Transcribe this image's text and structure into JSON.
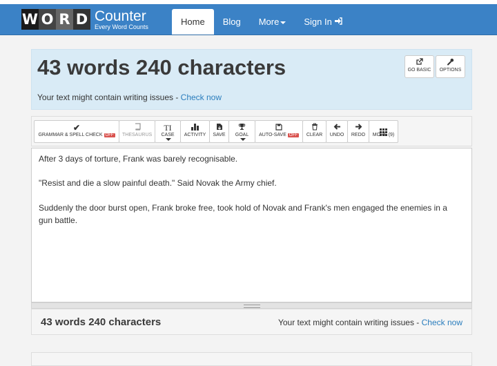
{
  "logo": {
    "letters": [
      "W",
      "O",
      "R",
      "D"
    ],
    "title": "Counter",
    "tagline": "Every Word Counts"
  },
  "nav": {
    "items": [
      {
        "label": "Home"
      },
      {
        "label": "Blog"
      },
      {
        "label": "More"
      },
      {
        "label": "Sign In"
      }
    ]
  },
  "hero": {
    "stats": "43 words 240 characters",
    "hint_prefix": "Your text might contain writing issues - ",
    "hint_link": "Check now",
    "buttons": [
      {
        "label": "GO BASIC",
        "icon": "external-link-icon"
      },
      {
        "label": "OPTIONS",
        "icon": "wrench-icon"
      }
    ]
  },
  "toolbar": {
    "grammar": {
      "label": "GRAMMAR & SPELL CHECK",
      "badge": "OFF",
      "icon": "check-icon"
    },
    "thesaurus": {
      "label": "THESAURUS",
      "icon": "book-icon"
    },
    "case": {
      "label": "CASE",
      "icon": "text-case-icon"
    },
    "activity": {
      "label": "ACTIVITY",
      "icon": "bar-chart-icon"
    },
    "save": {
      "label": "SAVE",
      "icon": "save-file-icon"
    },
    "goal": {
      "label": "GOAL",
      "icon": "trophy-icon"
    },
    "autosave": {
      "label": "AUTO-SAVE",
      "badge": "OFF",
      "icon": "floppy-icon"
    },
    "clear": {
      "label": "CLEAR",
      "icon": "trash-icon"
    },
    "undo": {
      "label": "UNDO",
      "icon": "arrow-left-icon"
    },
    "redo": {
      "label": "REDO",
      "icon": "arrow-right-icon"
    },
    "more": {
      "label": "MORE (9)",
      "icon": "grid-icon"
    }
  },
  "editor": {
    "paragraphs": [
      "After 3 days of torture, Frank was barely recognisable.",
      "\"Resist and die a slow painful death.\" Said Novak the Army chief.",
      "Suddenly the door burst open, Frank broke free, took hold of Novak and Frank's men engaged the enemies in a gun battle."
    ]
  },
  "footer": {
    "stats": "43 words 240 characters",
    "hint_prefix": "Your text might contain writing issues - ",
    "hint_link": "Check now"
  }
}
